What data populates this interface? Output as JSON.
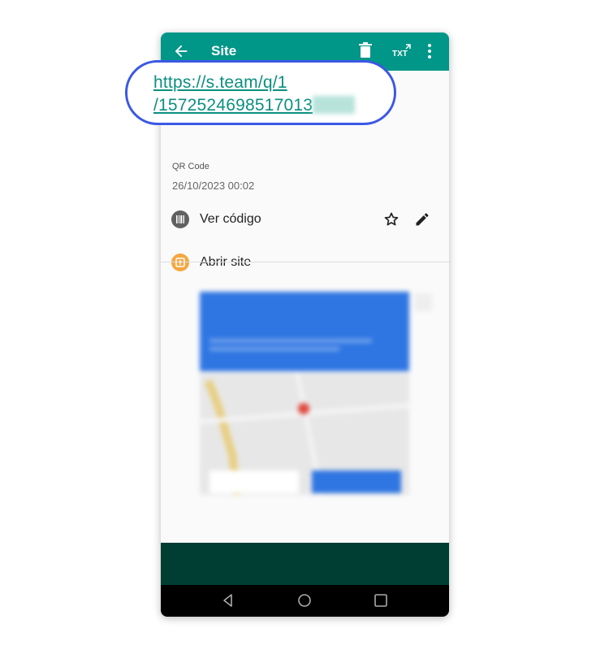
{
  "appbar": {
    "title": "Site",
    "icons": [
      "back-arrow-icon",
      "trash-icon",
      "txt-export-icon",
      "more-vert-icon"
    ],
    "color": "#009688"
  },
  "url": {
    "line1": "https://s.team/q/1",
    "line2": "/1572524698517013"
  },
  "meta": {
    "type": "QR Code",
    "date": "26/10/2023 00:02"
  },
  "actions": [
    {
      "label": "Ver código",
      "icon": "barcode-icon",
      "color": "#616161"
    },
    {
      "label": "Abrir site",
      "icon": "open-in-browser-icon",
      "color": "#f5a742"
    }
  ],
  "row_icons": [
    "star-outline-icon",
    "edit-pencil-icon"
  ],
  "navbar": {
    "icons": [
      "nav-back-icon",
      "nav-home-icon",
      "nav-recents-icon"
    ]
  },
  "colors": {
    "accent": "#009688",
    "callout": "#3b58e4",
    "link": "#0c8f80",
    "bottom_band": "#003d33"
  }
}
